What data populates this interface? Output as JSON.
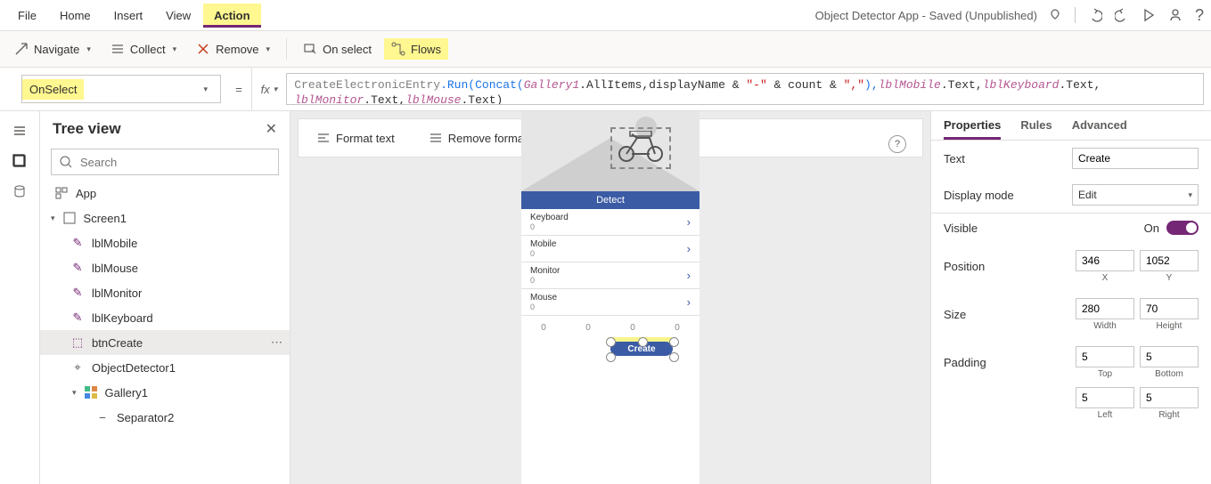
{
  "topMenu": [
    "File",
    "Home",
    "Insert",
    "View",
    "Action"
  ],
  "topTitle": "Object Detector App - Saved (Unpublished)",
  "ribbon": {
    "navigate": "Navigate",
    "collect": "Collect",
    "remove": "Remove",
    "onselect": "On select",
    "flows": "Flows"
  },
  "propertyDropdown": "OnSelect",
  "fx": "fx",
  "format": {
    "format": "Format text",
    "remove": "Remove formatting"
  },
  "tree": {
    "title": "Tree view",
    "searchPh": "Search",
    "app": "App",
    "screen": "Screen1",
    "items": [
      "lblMobile",
      "lblMouse",
      "lblMonitor",
      "lblKeyboard",
      "btnCreate",
      "ObjectDetector1",
      "Gallery1",
      "Separator2"
    ]
  },
  "device": {
    "detect": "Detect",
    "rows": [
      {
        "t": "Keyboard",
        "c": "0"
      },
      {
        "t": "Mobile",
        "c": "0"
      },
      {
        "t": "Monitor",
        "c": "0"
      },
      {
        "t": "Mouse",
        "c": "0"
      }
    ],
    "counts": [
      "0",
      "0",
      "0",
      "0"
    ],
    "create": "Create"
  },
  "props": {
    "tabs": [
      "Properties",
      "Rules",
      "Advanced"
    ],
    "text": {
      "l": "Text",
      "v": "Create"
    },
    "display": {
      "l": "Display mode",
      "v": "Edit"
    },
    "visible": {
      "l": "Visible",
      "v": "On"
    },
    "position": {
      "l": "Position",
      "x": "346",
      "y": "1052",
      "xL": "X",
      "yL": "Y"
    },
    "size": {
      "l": "Size",
      "w": "280",
      "h": "70",
      "wL": "Width",
      "hL": "Height"
    },
    "padding": {
      "l": "Padding",
      "t": "5",
      "b": "5",
      "le": "5",
      "r": "5",
      "tL": "Top",
      "bL": "Bottom",
      "leL": "Left",
      "rL": "Right"
    }
  },
  "formula": {
    "a": "CreateElectronicEntry",
    "b": ".Run(",
    "c": "Concat",
    "d": "(",
    "e": "Gallery1",
    "f": ".AllItems,displayName & ",
    "g": "\"-\"",
    "h": " & count & ",
    "i": "\",\"",
    "j": "),",
    "k": "lblMobile",
    "l": ".Text,",
    "m": "lblKeyboard",
    "n": ".Text,",
    "o": "lblMonitor",
    "p": ".Text,",
    "q": "lblMouse",
    "r": ".Text)"
  }
}
